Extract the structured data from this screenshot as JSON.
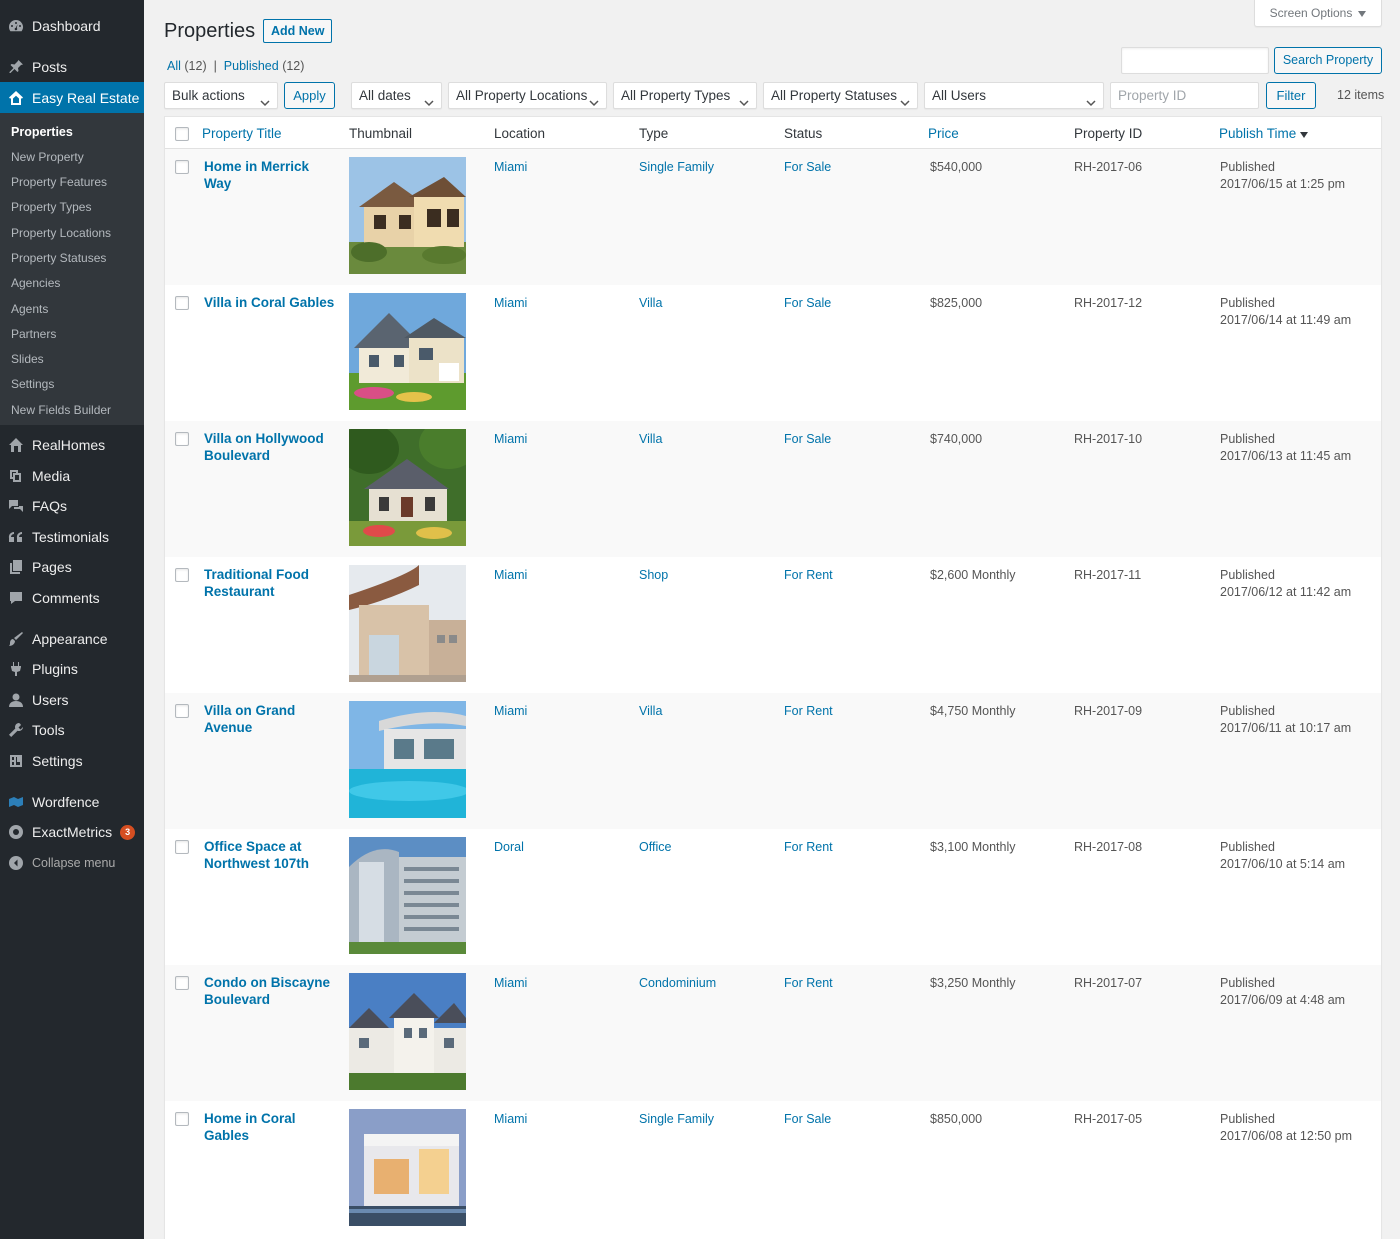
{
  "sidebar": {
    "dashboard": "Dashboard",
    "posts": "Posts",
    "easy_real_estate": "Easy Real Estate",
    "submenu": [
      "Properties",
      "New Property",
      "Property Features",
      "Property Types",
      "Property Locations",
      "Property Statuses",
      "Agencies",
      "Agents",
      "Partners",
      "Slides",
      "Settings",
      "New Fields Builder"
    ],
    "realhomes": "RealHomes",
    "media": "Media",
    "faqs": "FAQs",
    "testimonials": "Testimonials",
    "pages": "Pages",
    "comments": "Comments",
    "appearance": "Appearance",
    "plugins": "Plugins",
    "users": "Users",
    "tools": "Tools",
    "settings": "Settings",
    "wordfence": "Wordfence",
    "exactmetrics": "ExactMetrics",
    "exactmetrics_badge": "3",
    "collapse": "Collapse menu"
  },
  "header": {
    "screen_options": "Screen Options",
    "title": "Properties",
    "add_new": "Add New",
    "filter_all": "All",
    "filter_all_count": "(12)",
    "filter_published": "Published",
    "filter_published_count": "(12)",
    "search_button": "Search Property"
  },
  "filters": {
    "bulk_actions": "Bulk actions",
    "apply": "Apply",
    "dates": "All dates",
    "locations": "All Property Locations",
    "types": "All Property Types",
    "statuses": "All Property Statuses",
    "users": "All Users",
    "property_id_placeholder": "Property ID",
    "filter_button": "Filter",
    "items_count": "12 items"
  },
  "table": {
    "columns": [
      "Property Title",
      "Thumbnail",
      "Location",
      "Type",
      "Status",
      "Price",
      "Property ID",
      "Publish Time"
    ],
    "rows": [
      {
        "title": "Home in Merrick Way",
        "location": "Miami",
        "type": "Single Family",
        "status": "For Sale",
        "price": "$540,000",
        "id": "RH-2017-06",
        "pub_status": "Published",
        "pub_date": "2017/06/15 at 1:25 pm"
      },
      {
        "title": "Villa in Coral Gables",
        "location": "Miami",
        "type": "Villa",
        "status": "For Sale",
        "price": "$825,000",
        "id": "RH-2017-12",
        "pub_status": "Published",
        "pub_date": "2017/06/14 at 11:49 am"
      },
      {
        "title": "Villa on Hollywood Boulevard",
        "location": "Miami",
        "type": "Villa",
        "status": "For Sale",
        "price": "$740,000",
        "id": "RH-2017-10",
        "pub_status": "Published",
        "pub_date": "2017/06/13 at 11:45 am"
      },
      {
        "title": "Traditional Food Restaurant",
        "location": "Miami",
        "type": "Shop",
        "status": "For Rent",
        "price": "$2,600 Monthly",
        "id": "RH-2017-11",
        "pub_status": "Published",
        "pub_date": "2017/06/12 at 11:42 am"
      },
      {
        "title": "Villa on Grand Avenue",
        "location": "Miami",
        "type": "Villa",
        "status": "For Rent",
        "price": "$4,750 Monthly",
        "id": "RH-2017-09",
        "pub_status": "Published",
        "pub_date": "2017/06/11 at 10:17 am"
      },
      {
        "title": "Office Space at Northwest 107th",
        "location": "Doral",
        "type": "Office",
        "status": "For Rent",
        "price": "$3,100 Monthly",
        "id": "RH-2017-08",
        "pub_status": "Published",
        "pub_date": "2017/06/10 at 5:14 am"
      },
      {
        "title": "Condo on Biscayne Boulevard",
        "location": "Miami",
        "type": "Condominium",
        "status": "For Rent",
        "price": "$3,250 Monthly",
        "id": "RH-2017-07",
        "pub_status": "Published",
        "pub_date": "2017/06/09 at 4:48 am"
      },
      {
        "title": "Home in Coral Gables",
        "location": "Miami",
        "type": "Single Family",
        "status": "For Sale",
        "price": "$850,000",
        "id": "RH-2017-05",
        "pub_status": "Published",
        "pub_date": "2017/06/08 at 12:50 pm"
      }
    ]
  },
  "colors": {
    "accent": "#0073aa",
    "sidebar_bg": "#23282d",
    "submenu_bg": "#32373c",
    "page_bg": "#f1f1f1",
    "badge": "#d54e21"
  },
  "icons": [
    "dashboard-icon",
    "pin-icon",
    "house-icon",
    "realhomes-icon",
    "media-icon",
    "faq-icon",
    "quote-icon",
    "pages-icon",
    "comments-icon",
    "appearance-icon",
    "plugins-icon",
    "users-icon",
    "tools-icon",
    "settings-icon",
    "wordfence-icon",
    "exactmetrics-icon",
    "collapse-icon",
    "chevron-down-icon",
    "sort-arrow-icon"
  ]
}
